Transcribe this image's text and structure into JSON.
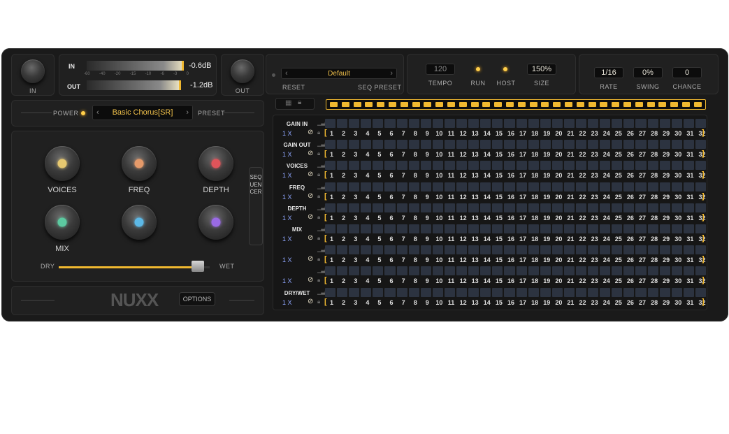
{
  "io": {
    "in_label": "IN",
    "out_label": "OUT",
    "meter_in_label": "IN",
    "meter_out_label": "OUT",
    "meter_in_value": "-0.6dB",
    "meter_out_value": "-1.2dB",
    "meter_scale": [
      "-60",
      "-40",
      "-20",
      "-15",
      "-10",
      "-6",
      "-3",
      "0"
    ]
  },
  "preset_bar": {
    "power_label": "POWER",
    "preset_name": "Basic Chorus[SR]",
    "preset_label": "PRESET"
  },
  "knobs": [
    {
      "label": "VOICES",
      "color": "#e6c870"
    },
    {
      "label": "FREQ",
      "color": "#e59a6a"
    },
    {
      "label": "DEPTH",
      "color": "#e0545a"
    },
    {
      "label": "MIX",
      "color": "#5cc9a0"
    },
    {
      "label": "",
      "color": "#5cb8e6"
    },
    {
      "label": "",
      "color": "#9a6ae6"
    }
  ],
  "mix_slider": {
    "left_label": "DRY",
    "right_label": "WET",
    "value": 0.92
  },
  "sequencer_tab": "SEQUENCER",
  "footer": {
    "logo": "NUXX",
    "options_label": "OPTIONS"
  },
  "seq_preset": {
    "reset_label": "RESET",
    "name": "Default",
    "label": "SEQ PRESET"
  },
  "transport": {
    "tempo_value": "120",
    "tempo_label": "TEMPO",
    "run_label": "RUN",
    "host_label": "HOST",
    "size_value": "150%",
    "size_label": "SIZE"
  },
  "rate": {
    "value": "1/16",
    "label": "RATE"
  },
  "swing": {
    "value": "0%",
    "label": "SWING"
  },
  "chance": {
    "value": "0",
    "label": "CHANCE"
  },
  "colors": {
    "accent": "#f0b830",
    "cell": "#2c3340",
    "rate_text": "#8fa6ff"
  },
  "seq_rows": [
    {
      "name": "GAIN IN",
      "rate": "1 X"
    },
    {
      "name": "GAIN OUT",
      "rate": "1 X"
    },
    {
      "name": "VOICES",
      "rate": "1 X"
    },
    {
      "name": "FREQ",
      "rate": "1 X"
    },
    {
      "name": "DEPTH",
      "rate": "1 X"
    },
    {
      "name": "MIX",
      "rate": "1 X"
    },
    {
      "name": "",
      "rate": "1 X"
    },
    {
      "name": "",
      "rate": "1 X"
    },
    {
      "name": "DRY/WET",
      "rate": "1 X"
    }
  ],
  "step_numbers": [
    "1",
    "2",
    "3",
    "4",
    "5",
    "6",
    "7",
    "8",
    "9",
    "10",
    "11",
    "12",
    "13",
    "14",
    "15",
    "16",
    "17",
    "18",
    "19",
    "20",
    "21",
    "22",
    "23",
    "24",
    "25",
    "26",
    "27",
    "28",
    "29",
    "30",
    "31",
    "32"
  ]
}
